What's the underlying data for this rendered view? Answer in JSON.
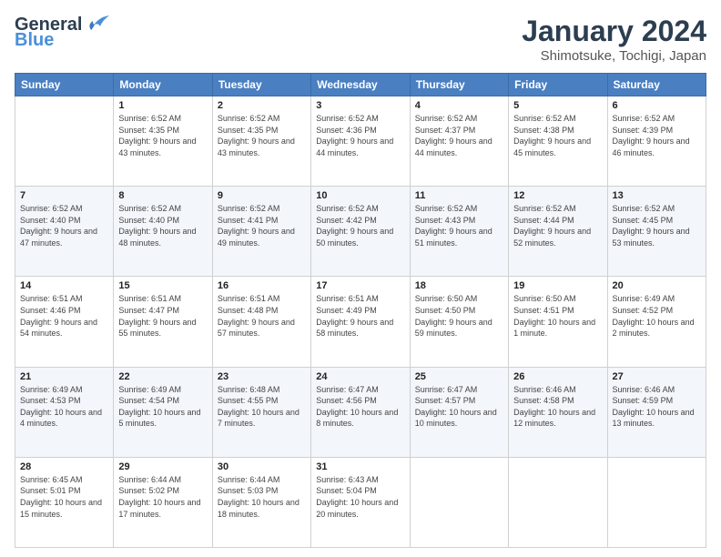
{
  "header": {
    "logo_line1": "General",
    "logo_line2": "Blue",
    "month_title": "January 2024",
    "location": "Shimotsuke, Tochigi, Japan"
  },
  "weekdays": [
    "Sunday",
    "Monday",
    "Tuesday",
    "Wednesday",
    "Thursday",
    "Friday",
    "Saturday"
  ],
  "weeks": [
    [
      {
        "day": "",
        "sunrise": "",
        "sunset": "",
        "daylight": ""
      },
      {
        "day": "1",
        "sunrise": "Sunrise: 6:52 AM",
        "sunset": "Sunset: 4:35 PM",
        "daylight": "Daylight: 9 hours and 43 minutes."
      },
      {
        "day": "2",
        "sunrise": "Sunrise: 6:52 AM",
        "sunset": "Sunset: 4:35 PM",
        "daylight": "Daylight: 9 hours and 43 minutes."
      },
      {
        "day": "3",
        "sunrise": "Sunrise: 6:52 AM",
        "sunset": "Sunset: 4:36 PM",
        "daylight": "Daylight: 9 hours and 44 minutes."
      },
      {
        "day": "4",
        "sunrise": "Sunrise: 6:52 AM",
        "sunset": "Sunset: 4:37 PM",
        "daylight": "Daylight: 9 hours and 44 minutes."
      },
      {
        "day": "5",
        "sunrise": "Sunrise: 6:52 AM",
        "sunset": "Sunset: 4:38 PM",
        "daylight": "Daylight: 9 hours and 45 minutes."
      },
      {
        "day": "6",
        "sunrise": "Sunrise: 6:52 AM",
        "sunset": "Sunset: 4:39 PM",
        "daylight": "Daylight: 9 hours and 46 minutes."
      }
    ],
    [
      {
        "day": "7",
        "sunrise": "Sunrise: 6:52 AM",
        "sunset": "Sunset: 4:40 PM",
        "daylight": "Daylight: 9 hours and 47 minutes."
      },
      {
        "day": "8",
        "sunrise": "Sunrise: 6:52 AM",
        "sunset": "Sunset: 4:40 PM",
        "daylight": "Daylight: 9 hours and 48 minutes."
      },
      {
        "day": "9",
        "sunrise": "Sunrise: 6:52 AM",
        "sunset": "Sunset: 4:41 PM",
        "daylight": "Daylight: 9 hours and 49 minutes."
      },
      {
        "day": "10",
        "sunrise": "Sunrise: 6:52 AM",
        "sunset": "Sunset: 4:42 PM",
        "daylight": "Daylight: 9 hours and 50 minutes."
      },
      {
        "day": "11",
        "sunrise": "Sunrise: 6:52 AM",
        "sunset": "Sunset: 4:43 PM",
        "daylight": "Daylight: 9 hours and 51 minutes."
      },
      {
        "day": "12",
        "sunrise": "Sunrise: 6:52 AM",
        "sunset": "Sunset: 4:44 PM",
        "daylight": "Daylight: 9 hours and 52 minutes."
      },
      {
        "day": "13",
        "sunrise": "Sunrise: 6:52 AM",
        "sunset": "Sunset: 4:45 PM",
        "daylight": "Daylight: 9 hours and 53 minutes."
      }
    ],
    [
      {
        "day": "14",
        "sunrise": "Sunrise: 6:51 AM",
        "sunset": "Sunset: 4:46 PM",
        "daylight": "Daylight: 9 hours and 54 minutes."
      },
      {
        "day": "15",
        "sunrise": "Sunrise: 6:51 AM",
        "sunset": "Sunset: 4:47 PM",
        "daylight": "Daylight: 9 hours and 55 minutes."
      },
      {
        "day": "16",
        "sunrise": "Sunrise: 6:51 AM",
        "sunset": "Sunset: 4:48 PM",
        "daylight": "Daylight: 9 hours and 57 minutes."
      },
      {
        "day": "17",
        "sunrise": "Sunrise: 6:51 AM",
        "sunset": "Sunset: 4:49 PM",
        "daylight": "Daylight: 9 hours and 58 minutes."
      },
      {
        "day": "18",
        "sunrise": "Sunrise: 6:50 AM",
        "sunset": "Sunset: 4:50 PM",
        "daylight": "Daylight: 9 hours and 59 minutes."
      },
      {
        "day": "19",
        "sunrise": "Sunrise: 6:50 AM",
        "sunset": "Sunset: 4:51 PM",
        "daylight": "Daylight: 10 hours and 1 minute."
      },
      {
        "day": "20",
        "sunrise": "Sunrise: 6:49 AM",
        "sunset": "Sunset: 4:52 PM",
        "daylight": "Daylight: 10 hours and 2 minutes."
      }
    ],
    [
      {
        "day": "21",
        "sunrise": "Sunrise: 6:49 AM",
        "sunset": "Sunset: 4:53 PM",
        "daylight": "Daylight: 10 hours and 4 minutes."
      },
      {
        "day": "22",
        "sunrise": "Sunrise: 6:49 AM",
        "sunset": "Sunset: 4:54 PM",
        "daylight": "Daylight: 10 hours and 5 minutes."
      },
      {
        "day": "23",
        "sunrise": "Sunrise: 6:48 AM",
        "sunset": "Sunset: 4:55 PM",
        "daylight": "Daylight: 10 hours and 7 minutes."
      },
      {
        "day": "24",
        "sunrise": "Sunrise: 6:47 AM",
        "sunset": "Sunset: 4:56 PM",
        "daylight": "Daylight: 10 hours and 8 minutes."
      },
      {
        "day": "25",
        "sunrise": "Sunrise: 6:47 AM",
        "sunset": "Sunset: 4:57 PM",
        "daylight": "Daylight: 10 hours and 10 minutes."
      },
      {
        "day": "26",
        "sunrise": "Sunrise: 6:46 AM",
        "sunset": "Sunset: 4:58 PM",
        "daylight": "Daylight: 10 hours and 12 minutes."
      },
      {
        "day": "27",
        "sunrise": "Sunrise: 6:46 AM",
        "sunset": "Sunset: 4:59 PM",
        "daylight": "Daylight: 10 hours and 13 minutes."
      }
    ],
    [
      {
        "day": "28",
        "sunrise": "Sunrise: 6:45 AM",
        "sunset": "Sunset: 5:01 PM",
        "daylight": "Daylight: 10 hours and 15 minutes."
      },
      {
        "day": "29",
        "sunrise": "Sunrise: 6:44 AM",
        "sunset": "Sunset: 5:02 PM",
        "daylight": "Daylight: 10 hours and 17 minutes."
      },
      {
        "day": "30",
        "sunrise": "Sunrise: 6:44 AM",
        "sunset": "Sunset: 5:03 PM",
        "daylight": "Daylight: 10 hours and 18 minutes."
      },
      {
        "day": "31",
        "sunrise": "Sunrise: 6:43 AM",
        "sunset": "Sunset: 5:04 PM",
        "daylight": "Daylight: 10 hours and 20 minutes."
      },
      {
        "day": "",
        "sunrise": "",
        "sunset": "",
        "daylight": ""
      },
      {
        "day": "",
        "sunrise": "",
        "sunset": "",
        "daylight": ""
      },
      {
        "day": "",
        "sunrise": "",
        "sunset": "",
        "daylight": ""
      }
    ]
  ]
}
